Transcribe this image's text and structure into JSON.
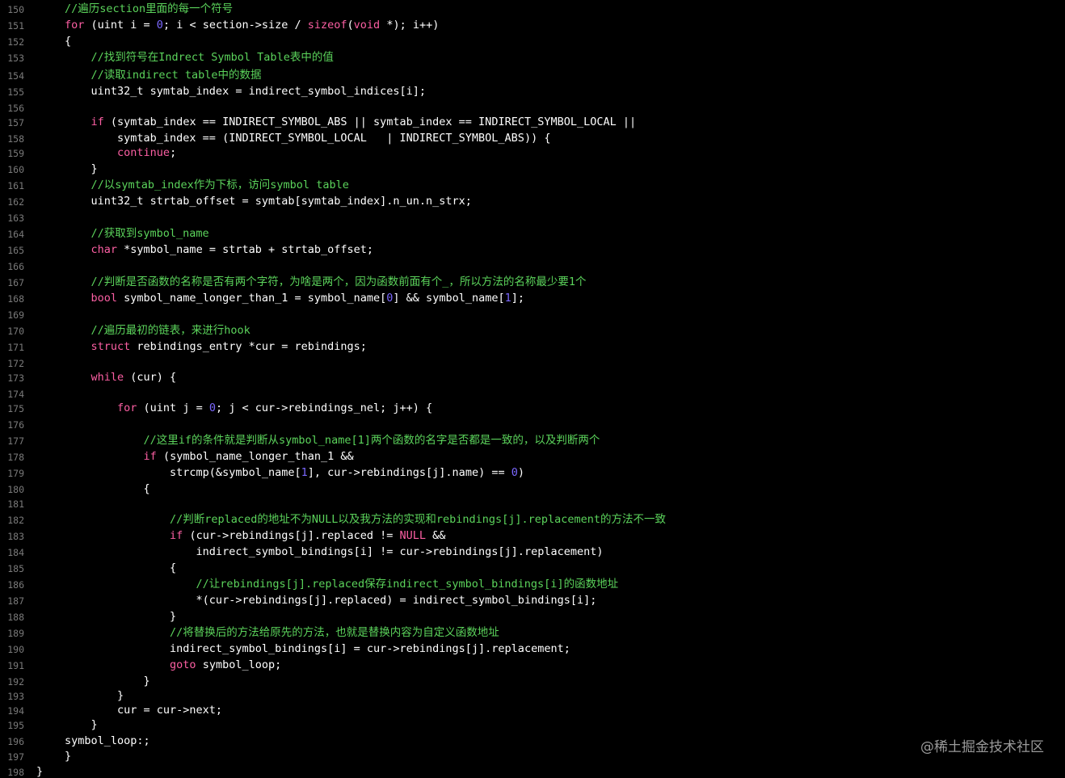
{
  "colors": {
    "background": "#000000",
    "line_number": "#7a7a7a",
    "plain": "#ffffff",
    "comment": "#5bd35b",
    "keyword": "#fc5fa3",
    "number": "#7b68ff",
    "watermark": "#9a9a9a"
  },
  "watermark": "@稀土掘金技术社区",
  "lines": [
    {
      "n": "150",
      "tokens": [
        {
          "t": "//遍历section里面的每一个符号",
          "k": "comment"
        }
      ]
    },
    {
      "n": "151",
      "tokens": [
        {
          "t": "for",
          "k": "keyword"
        },
        {
          "t": " (uint i = ",
          "k": "plain"
        },
        {
          "t": "0",
          "k": "number"
        },
        {
          "t": "; i < section->size / ",
          "k": "plain"
        },
        {
          "t": "sizeof",
          "k": "keyword"
        },
        {
          "t": "(",
          "k": "plain"
        },
        {
          "t": "void",
          "k": "keyword"
        },
        {
          "t": " *); i++)",
          "k": "plain"
        }
      ]
    },
    {
      "n": "152",
      "tokens": [
        {
          "t": "{",
          "k": "plain"
        }
      ]
    },
    {
      "n": "153",
      "tokens": [
        {
          "t": "    //找到符号在Indrect Symbol Table表中的值",
          "k": "comment"
        }
      ]
    },
    {
      "n": "154",
      "tokens": [
        {
          "t": "    //读取indirect table中的数据",
          "k": "comment"
        }
      ]
    },
    {
      "n": "155",
      "tokens": [
        {
          "t": "    uint32_t symtab_index = indirect_symbol_indices[i];",
          "k": "plain"
        }
      ]
    },
    {
      "n": "156",
      "tokens": []
    },
    {
      "n": "157",
      "tokens": [
        {
          "t": "    ",
          "k": "plain"
        },
        {
          "t": "if",
          "k": "keyword"
        },
        {
          "t": " (symtab_index == INDIRECT_SYMBOL_ABS || symtab_index == INDIRECT_SYMBOL_LOCAL ||",
          "k": "plain"
        }
      ]
    },
    {
      "n": "158",
      "tokens": [
        {
          "t": "        symtab_index == (INDIRECT_SYMBOL_LOCAL   | INDIRECT_SYMBOL_ABS)) {",
          "k": "plain"
        }
      ]
    },
    {
      "n": "159",
      "tokens": [
        {
          "t": "        ",
          "k": "plain"
        },
        {
          "t": "continue",
          "k": "keyword"
        },
        {
          "t": ";",
          "k": "plain"
        }
      ]
    },
    {
      "n": "160",
      "tokens": [
        {
          "t": "    }",
          "k": "plain"
        }
      ]
    },
    {
      "n": "161",
      "tokens": [
        {
          "t": "    //以symtab_index作为下标，访问symbol table",
          "k": "comment"
        }
      ]
    },
    {
      "n": "162",
      "tokens": [
        {
          "t": "    uint32_t strtab_offset = symtab[symtab_index].n_un.n_strx;",
          "k": "plain"
        }
      ]
    },
    {
      "n": "163",
      "tokens": []
    },
    {
      "n": "164",
      "tokens": [
        {
          "t": "    //获取到symbol_name",
          "k": "comment"
        }
      ]
    },
    {
      "n": "165",
      "tokens": [
        {
          "t": "    ",
          "k": "plain"
        },
        {
          "t": "char",
          "k": "keyword"
        },
        {
          "t": " *symbol_name = strtab + strtab_offset;",
          "k": "plain"
        }
      ]
    },
    {
      "n": "166",
      "tokens": []
    },
    {
      "n": "167",
      "tokens": [
        {
          "t": "    //判断是否函数的名称是否有两个字符，为啥是两个，因为函数前面有个_，所以方法的名称最少要1个",
          "k": "comment"
        }
      ]
    },
    {
      "n": "168",
      "tokens": [
        {
          "t": "    ",
          "k": "plain"
        },
        {
          "t": "bool",
          "k": "keyword"
        },
        {
          "t": " symbol_name_longer_than_1 = symbol_name[",
          "k": "plain"
        },
        {
          "t": "0",
          "k": "number"
        },
        {
          "t": "] && symbol_name[",
          "k": "plain"
        },
        {
          "t": "1",
          "k": "number"
        },
        {
          "t": "];",
          "k": "plain"
        }
      ]
    },
    {
      "n": "169",
      "tokens": []
    },
    {
      "n": "170",
      "tokens": [
        {
          "t": "    //遍历最初的链表，来进行hook",
          "k": "comment"
        }
      ]
    },
    {
      "n": "171",
      "tokens": [
        {
          "t": "    ",
          "k": "plain"
        },
        {
          "t": "struct",
          "k": "keyword"
        },
        {
          "t": " rebindings_entry *cur = rebindings;",
          "k": "plain"
        }
      ]
    },
    {
      "n": "172",
      "tokens": []
    },
    {
      "n": "173",
      "tokens": [
        {
          "t": "    ",
          "k": "plain"
        },
        {
          "t": "while",
          "k": "keyword"
        },
        {
          "t": " (cur) {",
          "k": "plain"
        }
      ]
    },
    {
      "n": "174",
      "tokens": []
    },
    {
      "n": "175",
      "tokens": [
        {
          "t": "        ",
          "k": "plain"
        },
        {
          "t": "for",
          "k": "keyword"
        },
        {
          "t": " (uint j = ",
          "k": "plain"
        },
        {
          "t": "0",
          "k": "number"
        },
        {
          "t": "; j < cur->rebindings_nel; j++) {",
          "k": "plain"
        }
      ]
    },
    {
      "n": "176",
      "tokens": []
    },
    {
      "n": "177",
      "tokens": [
        {
          "t": "            //这里if的条件就是判断从symbol_name[1]两个函数的名字是否都是一致的，以及判断两个",
          "k": "comment"
        }
      ]
    },
    {
      "n": "178",
      "tokens": [
        {
          "t": "            ",
          "k": "plain"
        },
        {
          "t": "if",
          "k": "keyword"
        },
        {
          "t": " (symbol_name_longer_than_1 &&",
          "k": "plain"
        }
      ]
    },
    {
      "n": "179",
      "tokens": [
        {
          "t": "                strcmp(&symbol_name[",
          "k": "plain"
        },
        {
          "t": "1",
          "k": "number"
        },
        {
          "t": "], cur->rebindings[j].name) == ",
          "k": "plain"
        },
        {
          "t": "0",
          "k": "number"
        },
        {
          "t": ")",
          "k": "plain"
        }
      ]
    },
    {
      "n": "180",
      "tokens": [
        {
          "t": "            {",
          "k": "plain"
        }
      ]
    },
    {
      "n": "181",
      "tokens": []
    },
    {
      "n": "182",
      "tokens": [
        {
          "t": "                //判断replaced的地址不为NULL以及我方法的实现和rebindings[j].replacement的方法不一致",
          "k": "comment"
        }
      ]
    },
    {
      "n": "183",
      "tokens": [
        {
          "t": "                ",
          "k": "plain"
        },
        {
          "t": "if",
          "k": "keyword"
        },
        {
          "t": " (cur->rebindings[j].replaced != ",
          "k": "plain"
        },
        {
          "t": "NULL",
          "k": "keyword"
        },
        {
          "t": " &&",
          "k": "plain"
        }
      ]
    },
    {
      "n": "184",
      "tokens": [
        {
          "t": "                    indirect_symbol_bindings[i] != cur->rebindings[j].replacement)",
          "k": "plain"
        }
      ]
    },
    {
      "n": "185",
      "tokens": [
        {
          "t": "                {",
          "k": "plain"
        }
      ]
    },
    {
      "n": "186",
      "tokens": [
        {
          "t": "                    //让rebindings[j].replaced保存indirect_symbol_bindings[i]的函数地址",
          "k": "comment"
        }
      ]
    },
    {
      "n": "187",
      "tokens": [
        {
          "t": "                    *(cur->rebindings[j].replaced) = indirect_symbol_bindings[i];",
          "k": "plain"
        }
      ]
    },
    {
      "n": "188",
      "tokens": [
        {
          "t": "                }",
          "k": "plain"
        }
      ]
    },
    {
      "n": "189",
      "tokens": [
        {
          "t": "                //将替换后的方法给原先的方法，也就是替换内容为自定义函数地址",
          "k": "comment"
        }
      ]
    },
    {
      "n": "190",
      "tokens": [
        {
          "t": "                indirect_symbol_bindings[i] = cur->rebindings[j].replacement;",
          "k": "plain"
        }
      ]
    },
    {
      "n": "191",
      "tokens": [
        {
          "t": "                ",
          "k": "plain"
        },
        {
          "t": "goto",
          "k": "keyword"
        },
        {
          "t": " symbol_loop;",
          "k": "plain"
        }
      ]
    },
    {
      "n": "192",
      "tokens": [
        {
          "t": "            }",
          "k": "plain"
        }
      ]
    },
    {
      "n": "193",
      "tokens": [
        {
          "t": "        }",
          "k": "plain"
        }
      ]
    },
    {
      "n": "194",
      "tokens": [
        {
          "t": "        cur = cur->next;",
          "k": "plain"
        }
      ]
    },
    {
      "n": "195",
      "tokens": [
        {
          "t": "    }",
          "k": "plain"
        }
      ]
    },
    {
      "n": "196",
      "tokens": [
        {
          "t": "symbol_loop:;",
          "k": "plain"
        }
      ]
    },
    {
      "n": "197",
      "tokens": [
        {
          "t": "}",
          "k": "plain"
        }
      ]
    },
    {
      "n": "198",
      "tokens": [
        {
          "t": "}",
          "k": "plain"
        }
      ]
    }
  ]
}
